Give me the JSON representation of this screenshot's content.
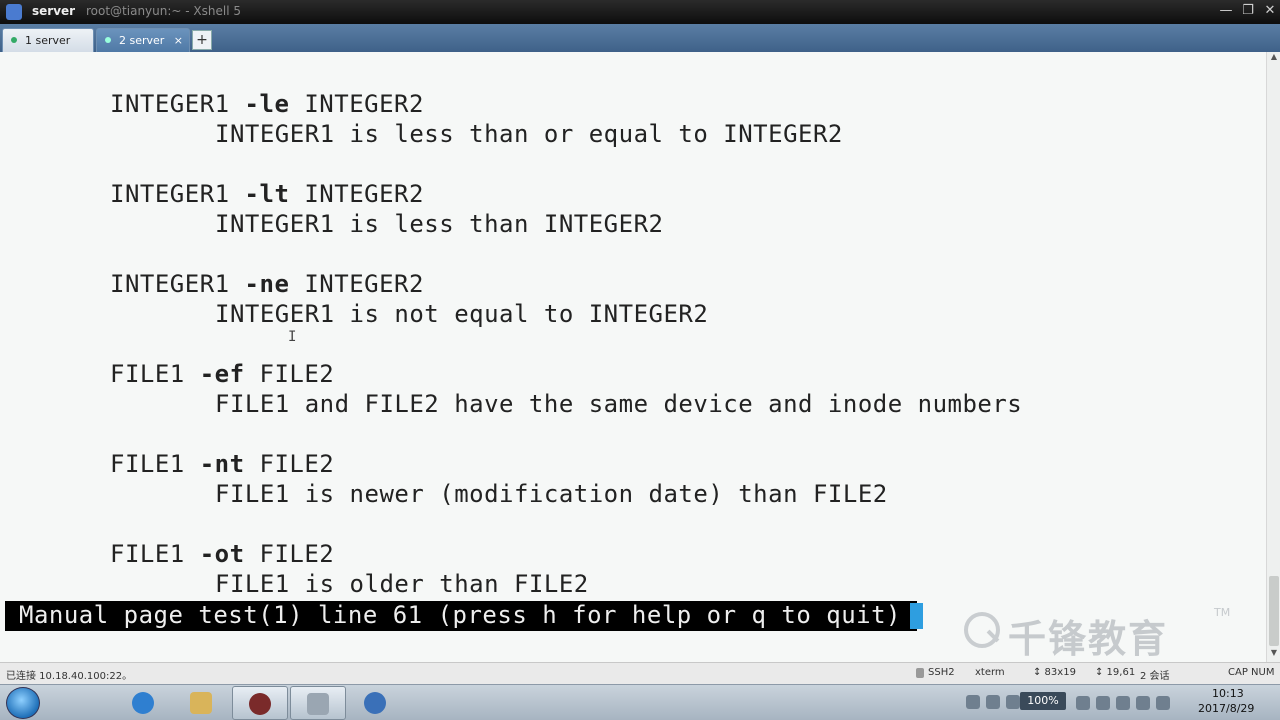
{
  "window": {
    "title_strong": "server",
    "title_sub": "root@tianyun:~ - Xshell 5",
    "min_glyph": "—",
    "max_glyph": "❐",
    "close_glyph": "✕"
  },
  "tabs": [
    {
      "label": "1 server",
      "close": ""
    },
    {
      "label": "2 server",
      "close": "×"
    }
  ],
  "tab_add_label": "+",
  "terminal": {
    "lines": [
      {
        "text_pre": "INTEGER1 ",
        "bold": "-le",
        "text_post": " INTEGER2"
      },
      {
        "text": "INTEGER1 is less than or equal to INTEGER2"
      },
      {
        "text_pre": "INTEGER1 ",
        "bold": "-lt",
        "text_post": " INTEGER2"
      },
      {
        "text": "INTEGER1 is less than INTEGER2"
      },
      {
        "text_pre": "INTEGER1 ",
        "bold": "-ne",
        "text_post": " INTEGER2"
      },
      {
        "text": "INTEGER1 is not equal to INTEGER2"
      },
      {
        "text_pre": "FILE1 ",
        "bold": "-ef",
        "text_post": " FILE2"
      },
      {
        "text": "FILE1 and FILE2 have the same device and inode numbers"
      },
      {
        "text_pre": "FILE1 ",
        "bold": "-nt",
        "text_post": " FILE2"
      },
      {
        "text": "FILE1 is newer (modification date) than FILE2"
      },
      {
        "text_pre": "FILE1 ",
        "bold": "-ot",
        "text_post": " FILE2"
      },
      {
        "text": "FILE1 is older than FILE2"
      }
    ],
    "status_line": "Manual page test(1) line 61 (press h for help or q to quit)"
  },
  "brand": {
    "name": "千锋教育",
    "tm": "TM"
  },
  "xshell_status": {
    "connection": "已连接 10.18.40.100:22。",
    "protocol": "SSH2",
    "terminal_type": "xterm",
    "size": "↕ 83x19",
    "position": "↕ 19,61",
    "sessions": "2 会话",
    "keys": "CAP NUM"
  },
  "taskbar": {
    "zoom": "100%",
    "time": "10:13",
    "date": "2017/8/29"
  }
}
